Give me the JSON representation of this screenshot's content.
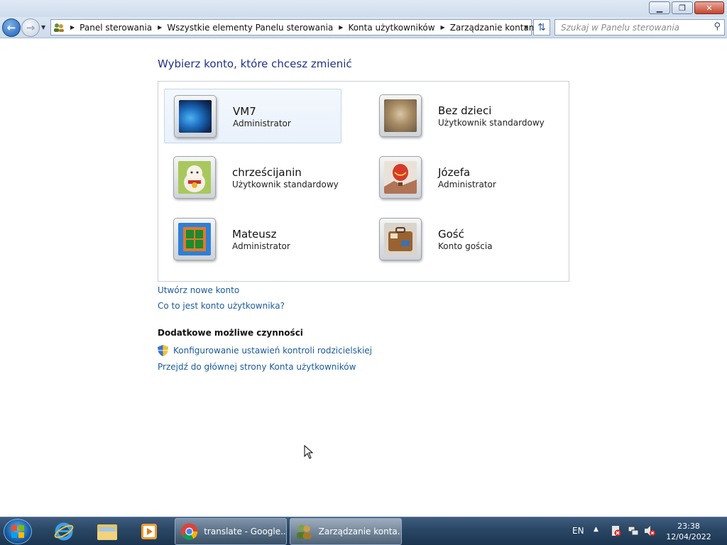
{
  "window": {
    "minimize_label": "▁",
    "maximize_label": "❐",
    "close_label": "✕"
  },
  "navbar": {
    "breadcrumbs": [
      "Panel sterowania",
      "Wszystkie elementy Panelu sterowania",
      "Konta użytkowników",
      "Zarządzanie kontami"
    ],
    "search_placeholder": "Szukaj w Panelu sterowania"
  },
  "main": {
    "title": "Wybierz konto, które chcesz zmienić",
    "accounts": [
      {
        "name": "VM7",
        "type": "Administrator",
        "picture": "blue-swirl",
        "selected": true
      },
      {
        "name": "Bez dzieci",
        "type": "Użytkownik standardowy",
        "picture": "kitten"
      },
      {
        "name": "chrześcijanin",
        "type": "Użytkownik standardowy",
        "picture": "lucky-cat"
      },
      {
        "name": "Józefa",
        "type": "Administrator",
        "picture": "hot-air-balloon"
      },
      {
        "name": "Mateusz",
        "type": "Administrator",
        "picture": "window-frame"
      },
      {
        "name": "Gość",
        "type": "Konto gościa",
        "picture": "suitcase"
      }
    ],
    "links": {
      "create_account": "Utwórz nowe konto",
      "what_is_account": "Co to jest konto użytkownika?"
    },
    "additional": {
      "title": "Dodatkowe możliwe czynności",
      "parental_controls": "Konfigurowanie ustawień kontroli rodzicielskiej",
      "main_page": "Przejdź do głównej strony Konta użytkowników"
    }
  },
  "taskbar": {
    "tasks": [
      {
        "label": "translate - Google...",
        "icon": "chrome-icon"
      },
      {
        "label": "Zarządzanie konta...",
        "icon": "users-icon"
      }
    ],
    "language": "EN",
    "time": "23:38",
    "date": "12/04/2022"
  }
}
